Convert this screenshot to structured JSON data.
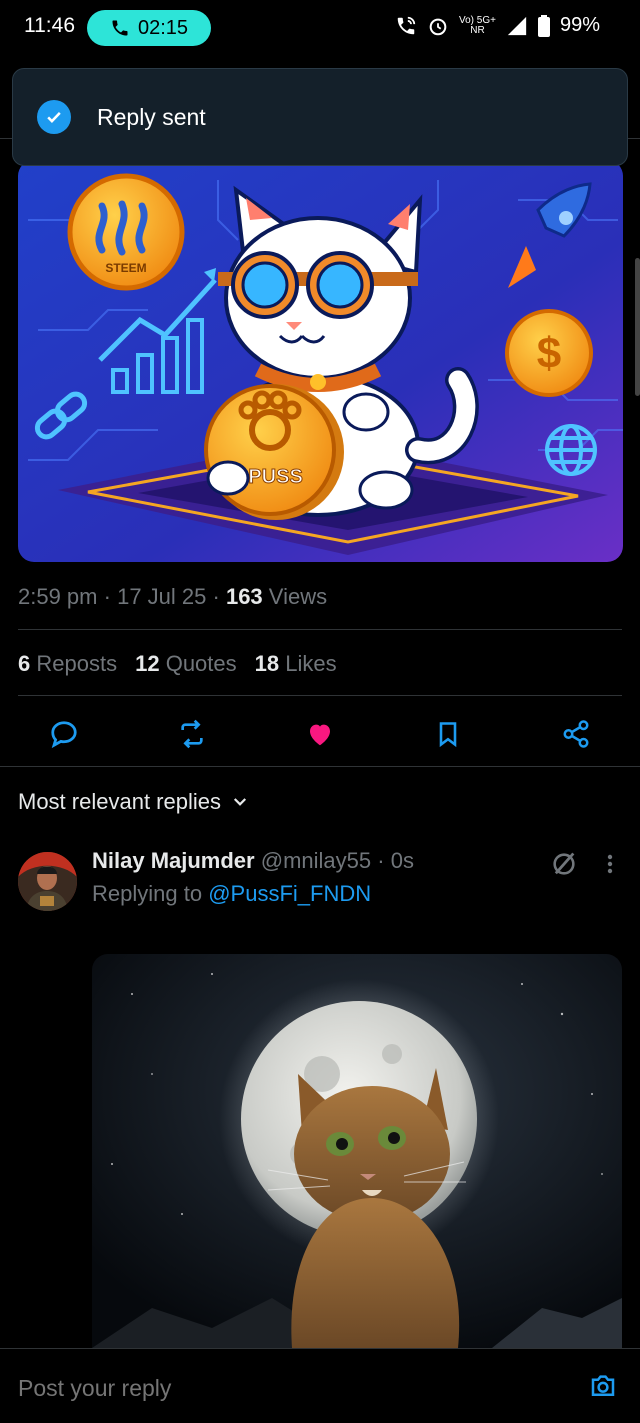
{
  "status_bar": {
    "time": "11:46",
    "call_timer": "02:15",
    "network_top": "Vo) 5G+",
    "network_bottom": "NR",
    "battery": "99%"
  },
  "toast": {
    "text": "Reply sent"
  },
  "post": {
    "image_text": {
      "coin_left": "STEEM",
      "coin_center": "$PUSS",
      "coin_right": "$"
    },
    "time": "2:59 pm",
    "date": "17 Jul 25",
    "views_count": "163",
    "views_label": "Views",
    "reposts_count": "6",
    "reposts_label": "Reposts",
    "quotes_count": "12",
    "quotes_label": "Quotes",
    "likes_count": "18",
    "likes_label": "Likes"
  },
  "replies": {
    "sort_label": "Most relevant replies",
    "items": [
      {
        "name": "Nilay Majumder",
        "handle": "@mnilay55",
        "age": "0s",
        "replying_prefix": "Replying to",
        "replying_to": "@PussFi_FNDN"
      }
    ]
  },
  "compose": {
    "placeholder": "Post your reply"
  },
  "colors": {
    "accent": "#1d9bf0",
    "like": "#f91880",
    "call_pill": "#2de4d8",
    "background": "#000000",
    "muted": "#71767b"
  }
}
